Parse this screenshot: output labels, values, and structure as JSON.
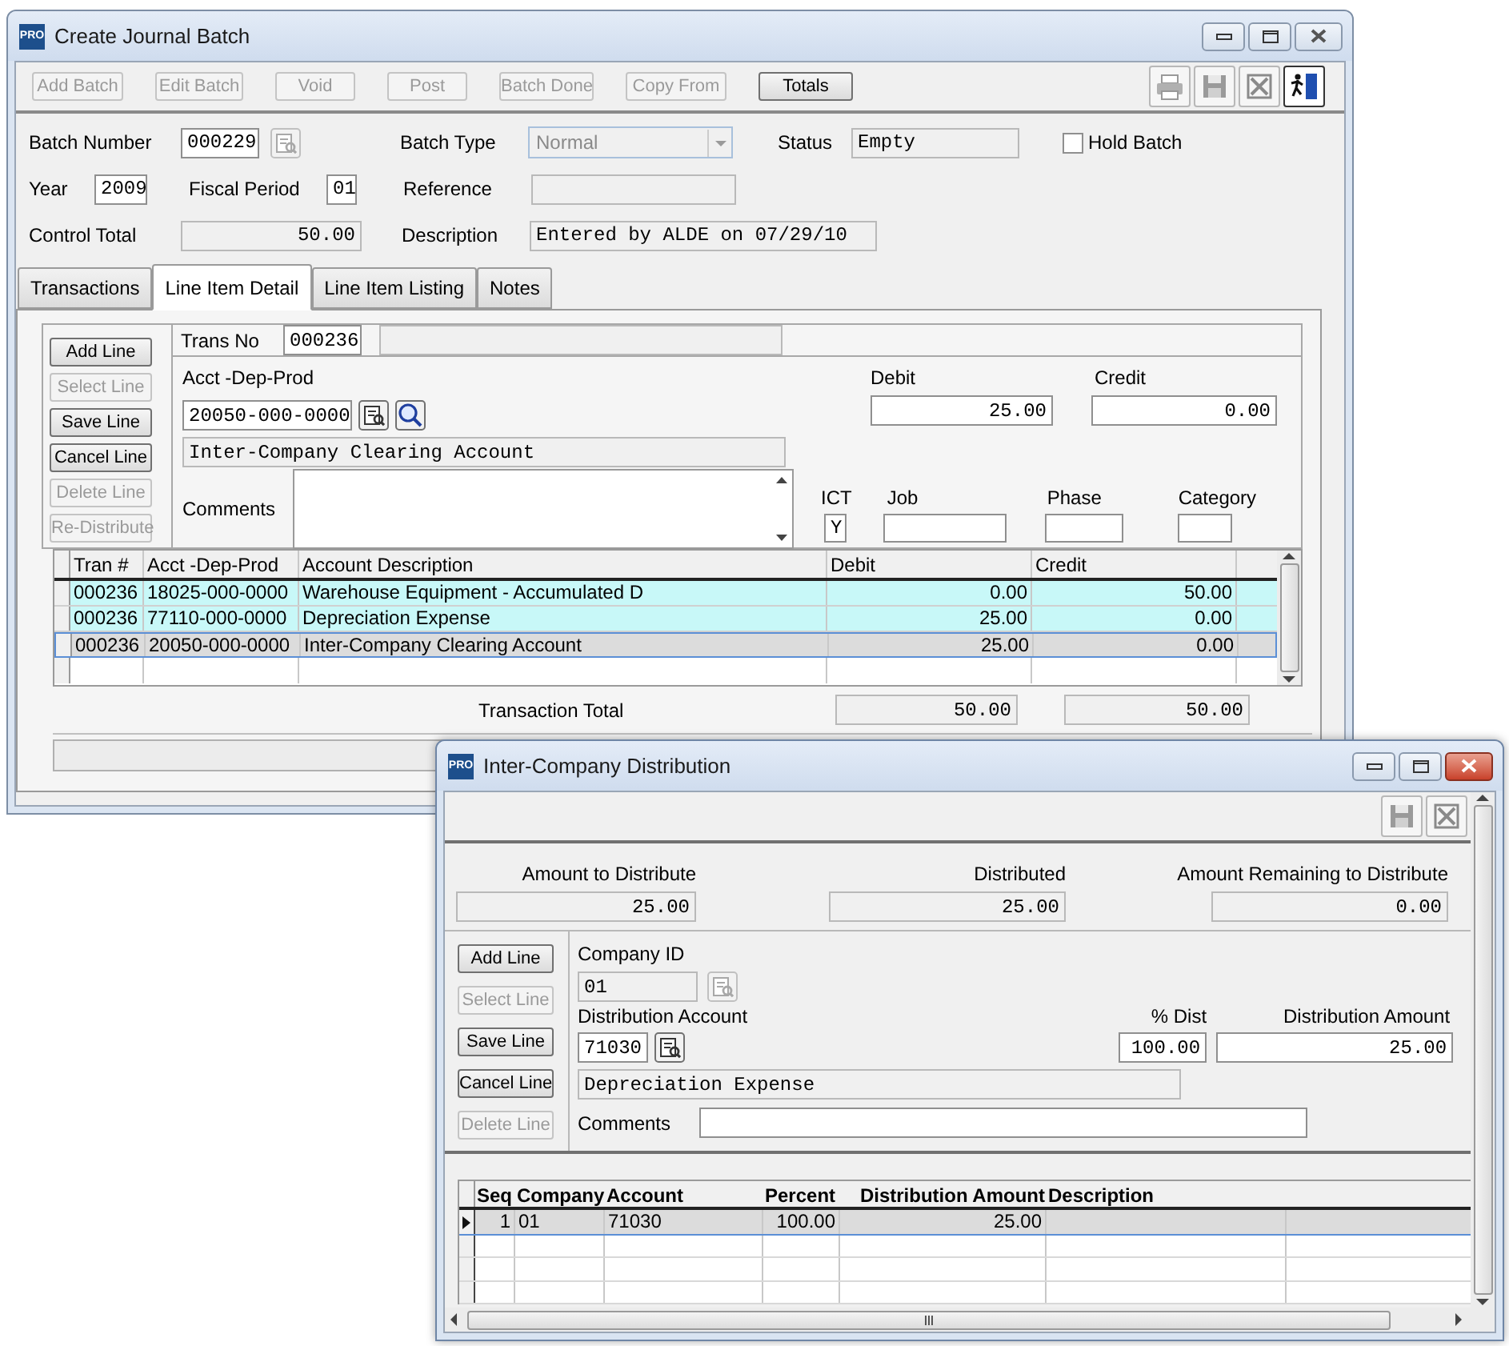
{
  "main_window": {
    "logo": "PRO",
    "title": "Create Journal Batch",
    "toolbar": [
      {
        "label": "Add Batch",
        "disabled": true
      },
      {
        "label": "Edit Batch",
        "disabled": true
      },
      {
        "label": "Void",
        "disabled": true
      },
      {
        "label": "Post",
        "disabled": true
      },
      {
        "label": "Batch Done",
        "disabled": true
      },
      {
        "label": "Copy From",
        "disabled": true
      },
      {
        "label": "Totals",
        "disabled": false
      }
    ],
    "batch_number": {
      "label": "Batch Number",
      "value": "000229",
      "disabled": false
    },
    "batch_type": {
      "label": "Batch Type",
      "value": "Normal",
      "disabled": true
    },
    "status": {
      "label": "Status",
      "value": "Empty",
      "disabled": true
    },
    "hold_batch": {
      "label": "Hold Batch",
      "checked": false
    },
    "year": {
      "label": "Year",
      "value": "2009",
      "disabled": false
    },
    "fiscal_period": {
      "label": "Fiscal Period",
      "value": "01",
      "disabled": false
    },
    "reference": {
      "label": "Reference",
      "disabled": true
    },
    "control_total": {
      "label": "Control Total",
      "value": "50.00",
      "disabled": true
    },
    "description": {
      "label": "Description",
      "value": "Entered by ALDE on 07/29/10",
      "disabled": true
    },
    "tabs": [
      {
        "label": "Transactions",
        "selected": false
      },
      {
        "label": "Line Item Detail",
        "selected": true
      },
      {
        "label": "Line Item Listing",
        "selected": false
      },
      {
        "label": "Notes",
        "selected": false
      }
    ],
    "line_buttons": [
      {
        "label": "Add Line",
        "disabled": false
      },
      {
        "label": "Select Line",
        "disabled": true
      },
      {
        "label": "Save Line",
        "disabled": false
      },
      {
        "label": "Cancel Line",
        "disabled": false
      },
      {
        "label": "Delete Line",
        "disabled": true
      },
      {
        "label": "Re-Distribute",
        "disabled": true
      }
    ],
    "trans_no": {
      "label": "Trans No",
      "value": "000236",
      "disabled": false
    },
    "account": {
      "label": "Acct -Dep-Prod",
      "value": "20050-000-0000",
      "disabled": false
    },
    "account_description": {
      "value": "Inter-Company Clearing Account",
      "disabled": true
    },
    "debit": {
      "label": "Debit",
      "value": "25.00",
      "disabled": false
    },
    "credit": {
      "label": "Credit",
      "value": "0.00",
      "disabled": false
    },
    "comments": {
      "label": "Comments"
    },
    "ict": {
      "label": "ICT",
      "value": "Y",
      "disabled": false
    },
    "job": {
      "label": "Job"
    },
    "phase": {
      "label": "Phase"
    },
    "category": {
      "label": "Category"
    },
    "grid": {
      "columns": [
        "Tran #",
        "Acct -Dep-Prod",
        "Account Description",
        "Debit",
        "Credit"
      ],
      "rows": [
        {
          "cells": [
            "000236",
            "18025-000-0000",
            "Warehouse Equipment - Accumulated D",
            "0.00",
            "50.00"
          ],
          "selected": false
        },
        {
          "cells": [
            "000236",
            "77110-000-0000",
            "Depreciation Expense",
            "25.00",
            "0.00"
          ],
          "selected": false
        },
        {
          "cells": [
            "000236",
            "20050-000-0000",
            "Inter-Company Clearing Account",
            "25.00",
            "0.00"
          ],
          "selected": true
        }
      ]
    },
    "transaction_total": {
      "label": "Transaction Total",
      "debit": "50.00",
      "credit": "50.00"
    }
  },
  "dialog": {
    "logo": "PRO",
    "title": "Inter-Company Distribution",
    "summary": [
      {
        "label": "Amount to Distribute",
        "value": "25.00"
      },
      {
        "label": "Distributed",
        "value": "25.00"
      },
      {
        "label": "Amount Remaining to Distribute",
        "value": "0.00"
      }
    ],
    "line_buttons": [
      {
        "label": "Add Line",
        "disabled": false
      },
      {
        "label": "Select Line",
        "disabled": true
      },
      {
        "label": "Save Line",
        "disabled": false
      },
      {
        "label": "Cancel Line",
        "disabled": false
      },
      {
        "label": "Delete Line",
        "disabled": true
      }
    ],
    "company_id": {
      "label": "Company ID",
      "value": "01",
      "disabled": true
    },
    "distribution_account": {
      "label": "Distribution Account",
      "value": "71030",
      "disabled": false
    },
    "account_description": {
      "value": "Depreciation Expense",
      "disabled": true
    },
    "percent_dist": {
      "label": "% Dist",
      "value": "100.00",
      "disabled": false
    },
    "distribution_amount": {
      "label": "Distribution Amount",
      "value": "25.00",
      "disabled": false
    },
    "comments": {
      "label": "Comments"
    },
    "grid": {
      "columns": [
        "Seq",
        "Company",
        "Account",
        "Percent",
        "Distribution Amount",
        "Description"
      ],
      "rows": [
        {
          "cells": [
            "1",
            "01",
            "71030",
            "100.00",
            "25.00"
          ],
          "selected": true
        }
      ]
    }
  }
}
